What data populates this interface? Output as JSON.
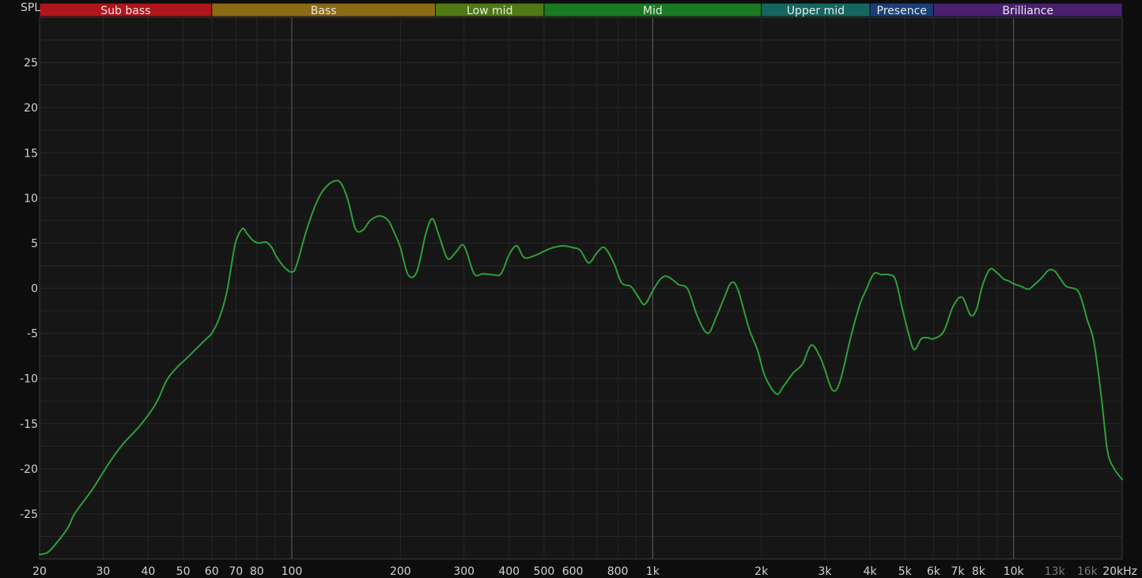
{
  "chart_data": {
    "type": "line",
    "ylabel": "SPL",
    "xscale": "log",
    "xlim": [
      20,
      20000
    ],
    "ylim": [
      -30,
      30
    ],
    "yticks": [
      25,
      20,
      15,
      10,
      5,
      0,
      -5,
      -10,
      -15,
      -20,
      -25
    ],
    "xticks": [
      {
        "value": 20,
        "label": "20"
      },
      {
        "value": 30,
        "label": "30"
      },
      {
        "value": 40,
        "label": "40"
      },
      {
        "value": 50,
        "label": "50"
      },
      {
        "value": 60,
        "label": "60"
      },
      {
        "value": 70,
        "label": "70"
      },
      {
        "value": 80,
        "label": "80"
      },
      {
        "value": 100,
        "label": "100"
      },
      {
        "value": 200,
        "label": "200"
      },
      {
        "value": 300,
        "label": "300"
      },
      {
        "value": 400,
        "label": "400"
      },
      {
        "value": 500,
        "label": "500"
      },
      {
        "value": 600,
        "label": "600"
      },
      {
        "value": 800,
        "label": "800"
      },
      {
        "value": 1000,
        "label": "1k"
      },
      {
        "value": 2000,
        "label": "2k"
      },
      {
        "value": 3000,
        "label": "3k"
      },
      {
        "value": 4000,
        "label": "4k"
      },
      {
        "value": 5000,
        "label": "5k"
      },
      {
        "value": 6000,
        "label": "6k"
      },
      {
        "value": 7000,
        "label": "7k"
      },
      {
        "value": 8000,
        "label": "8k"
      },
      {
        "value": 10000,
        "label": "10k"
      },
      {
        "value": 13000,
        "label": "13k",
        "dim": true
      },
      {
        "value": 16000,
        "label": "16k",
        "dim": true
      },
      {
        "value": 20000,
        "label": "20kHz"
      }
    ],
    "bands": [
      {
        "name": "Sub bass",
        "from": 20,
        "to": 60,
        "color": "#b0151c"
      },
      {
        "name": "Bass",
        "from": 60,
        "to": 250,
        "color": "#8c6a14"
      },
      {
        "name": "Low mid",
        "from": 250,
        "to": 500,
        "color": "#4f7a14"
      },
      {
        "name": "Mid",
        "from": 500,
        "to": 2000,
        "color": "#1a7a24"
      },
      {
        "name": "Upper mid",
        "from": 2000,
        "to": 4000,
        "color": "#156660"
      },
      {
        "name": "Presence",
        "from": 4000,
        "to": 6000,
        "color": "#1a3f78"
      },
      {
        "name": "Brilliance",
        "from": 6000,
        "to": 20000,
        "color": "#4a2070"
      }
    ],
    "line_color": "#2e9e3a",
    "grid": true,
    "series": [
      {
        "x": [
          20,
          21,
          22,
          24,
          25,
          28,
          31,
          34,
          38,
          42,
          45,
          48,
          51,
          55,
          58,
          60,
          63,
          66,
          68,
          70,
          73,
          75,
          78,
          81,
          85,
          88,
          91,
          96,
          100,
          103,
          110,
          118,
          125,
          132,
          137,
          143,
          150,
          157,
          165,
          175,
          185,
          193,
          200,
          210,
          222,
          235,
          245,
          255,
          270,
          285,
          300,
          320,
          338,
          360,
          380,
          400,
          420,
          440,
          470,
          500,
          530,
          565,
          600,
          630,
          665,
          700,
          735,
          780,
          820,
          870,
          910,
          950,
          1000,
          1050,
          1100,
          1180,
          1250,
          1330,
          1420,
          1500,
          1580,
          1650,
          1720,
          1850,
          1950,
          2050,
          2200,
          2300,
          2450,
          2600,
          2750,
          2900,
          3000,
          3150,
          3300,
          3550,
          3750,
          3900,
          4100,
          4300,
          4500,
          4700,
          4900,
          5100,
          5300,
          5550,
          5800,
          6000,
          6400,
          6800,
          7200,
          7600,
          7900,
          8200,
          8600,
          9000,
          9400,
          9700,
          10000,
          10500,
          11000,
          11500,
          12000,
          12500,
          13000,
          13500,
          14000,
          15000,
          15500,
          16000,
          16700,
          17500,
          18200,
          19000,
          20000
        ],
        "y": [
          -29.5,
          -29.3,
          -28.5,
          -26.5,
          -25.0,
          -22.3,
          -19.5,
          -17.3,
          -15.2,
          -12.8,
          -10.2,
          -8.8,
          -7.8,
          -6.5,
          -5.6,
          -5.0,
          -3.3,
          -0.5,
          2.5,
          5.2,
          6.6,
          6.1,
          5.3,
          5.0,
          5.1,
          4.5,
          3.4,
          2.2,
          1.8,
          2.5,
          6.5,
          9.8,
          11.3,
          11.9,
          11.6,
          9.8,
          6.6,
          6.4,
          7.5,
          8.0,
          7.5,
          6.0,
          4.5,
          1.5,
          1.8,
          6.0,
          7.7,
          6.0,
          3.3,
          4.0,
          4.7,
          1.6,
          1.6,
          1.5,
          1.6,
          3.7,
          4.7,
          3.4,
          3.6,
          4.1,
          4.5,
          4.7,
          4.5,
          4.2,
          2.8,
          3.9,
          4.5,
          2.8,
          0.6,
          0.2,
          -0.9,
          -1.8,
          -0.3,
          1.0,
          1.3,
          0.4,
          -0.1,
          -3.1,
          -5.0,
          -3.2,
          -1.0,
          0.6,
          -0.1,
          -4.5,
          -6.8,
          -9.8,
          -11.7,
          -10.9,
          -9.4,
          -8.4,
          -6.3,
          -7.5,
          -9.0,
          -11.3,
          -10.4,
          -5.2,
          -1.8,
          -0.2,
          1.6,
          1.5,
          1.5,
          1.0,
          -2.0,
          -4.8,
          -6.8,
          -5.6,
          -5.5,
          -5.6,
          -4.8,
          -2.0,
          -1.0,
          -3.0,
          -2.3,
          0.3,
          2.1,
          1.7,
          1.0,
          0.8,
          0.5,
          0.2,
          -0.1,
          0.5,
          1.2,
          2.0,
          1.9,
          1.0,
          0.2,
          -0.2,
          -1.5,
          -3.5,
          -6.0,
          -12.0,
          -18.0,
          -20.0,
          -21.2
        ]
      }
    ]
  }
}
